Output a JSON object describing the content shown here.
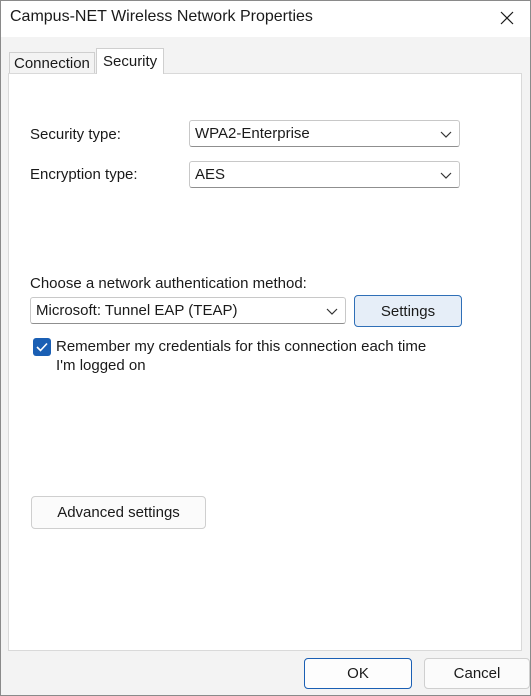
{
  "window": {
    "title": "Campus-NET Wireless Network Properties"
  },
  "tabs": [
    {
      "label": "Connection"
    },
    {
      "label": "Security"
    }
  ],
  "security": {
    "security_type_label": "Security type:",
    "security_type_value": "WPA2-Enterprise",
    "encryption_type_label": "Encryption type:",
    "encryption_type_value": "AES",
    "auth_method_label": "Choose a network authentication method:",
    "auth_method_value": "Microsoft: Tunnel EAP (TEAP)",
    "settings_label": "Settings",
    "remember_label": "Remember my credentials for this connection each time I'm logged on",
    "remember_checked": true,
    "advanced_label": "Advanced settings"
  },
  "footer": {
    "ok_label": "OK",
    "cancel_label": "Cancel"
  },
  "colors": {
    "accent": "#1a5fb4",
    "settings_bg": "#e6eef8"
  },
  "icons": {
    "close": "close-icon",
    "dropdown": "chevron-down-icon",
    "check": "check-icon"
  }
}
